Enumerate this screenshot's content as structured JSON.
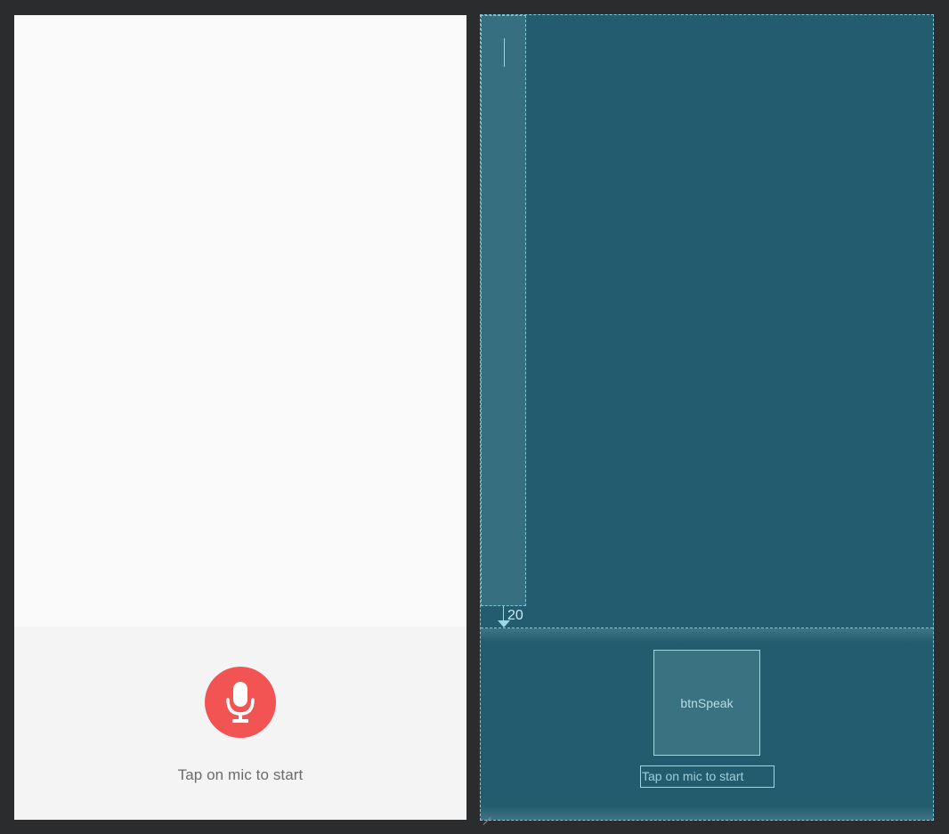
{
  "design": {
    "mic_icon": "mic-icon",
    "hint_text": "Tap on mic to start",
    "colors": {
      "surface": "#fafafa",
      "panel": "#f4f4f4",
      "mic_button": "#f25353",
      "hint_text": "#6b6b6b"
    }
  },
  "blueprint": {
    "margin_label": "20",
    "button_id": "btnSpeak",
    "text_label": "Tap on mic to start",
    "colors": {
      "background": "#235c6e",
      "outline": "#7fc7d8"
    }
  }
}
